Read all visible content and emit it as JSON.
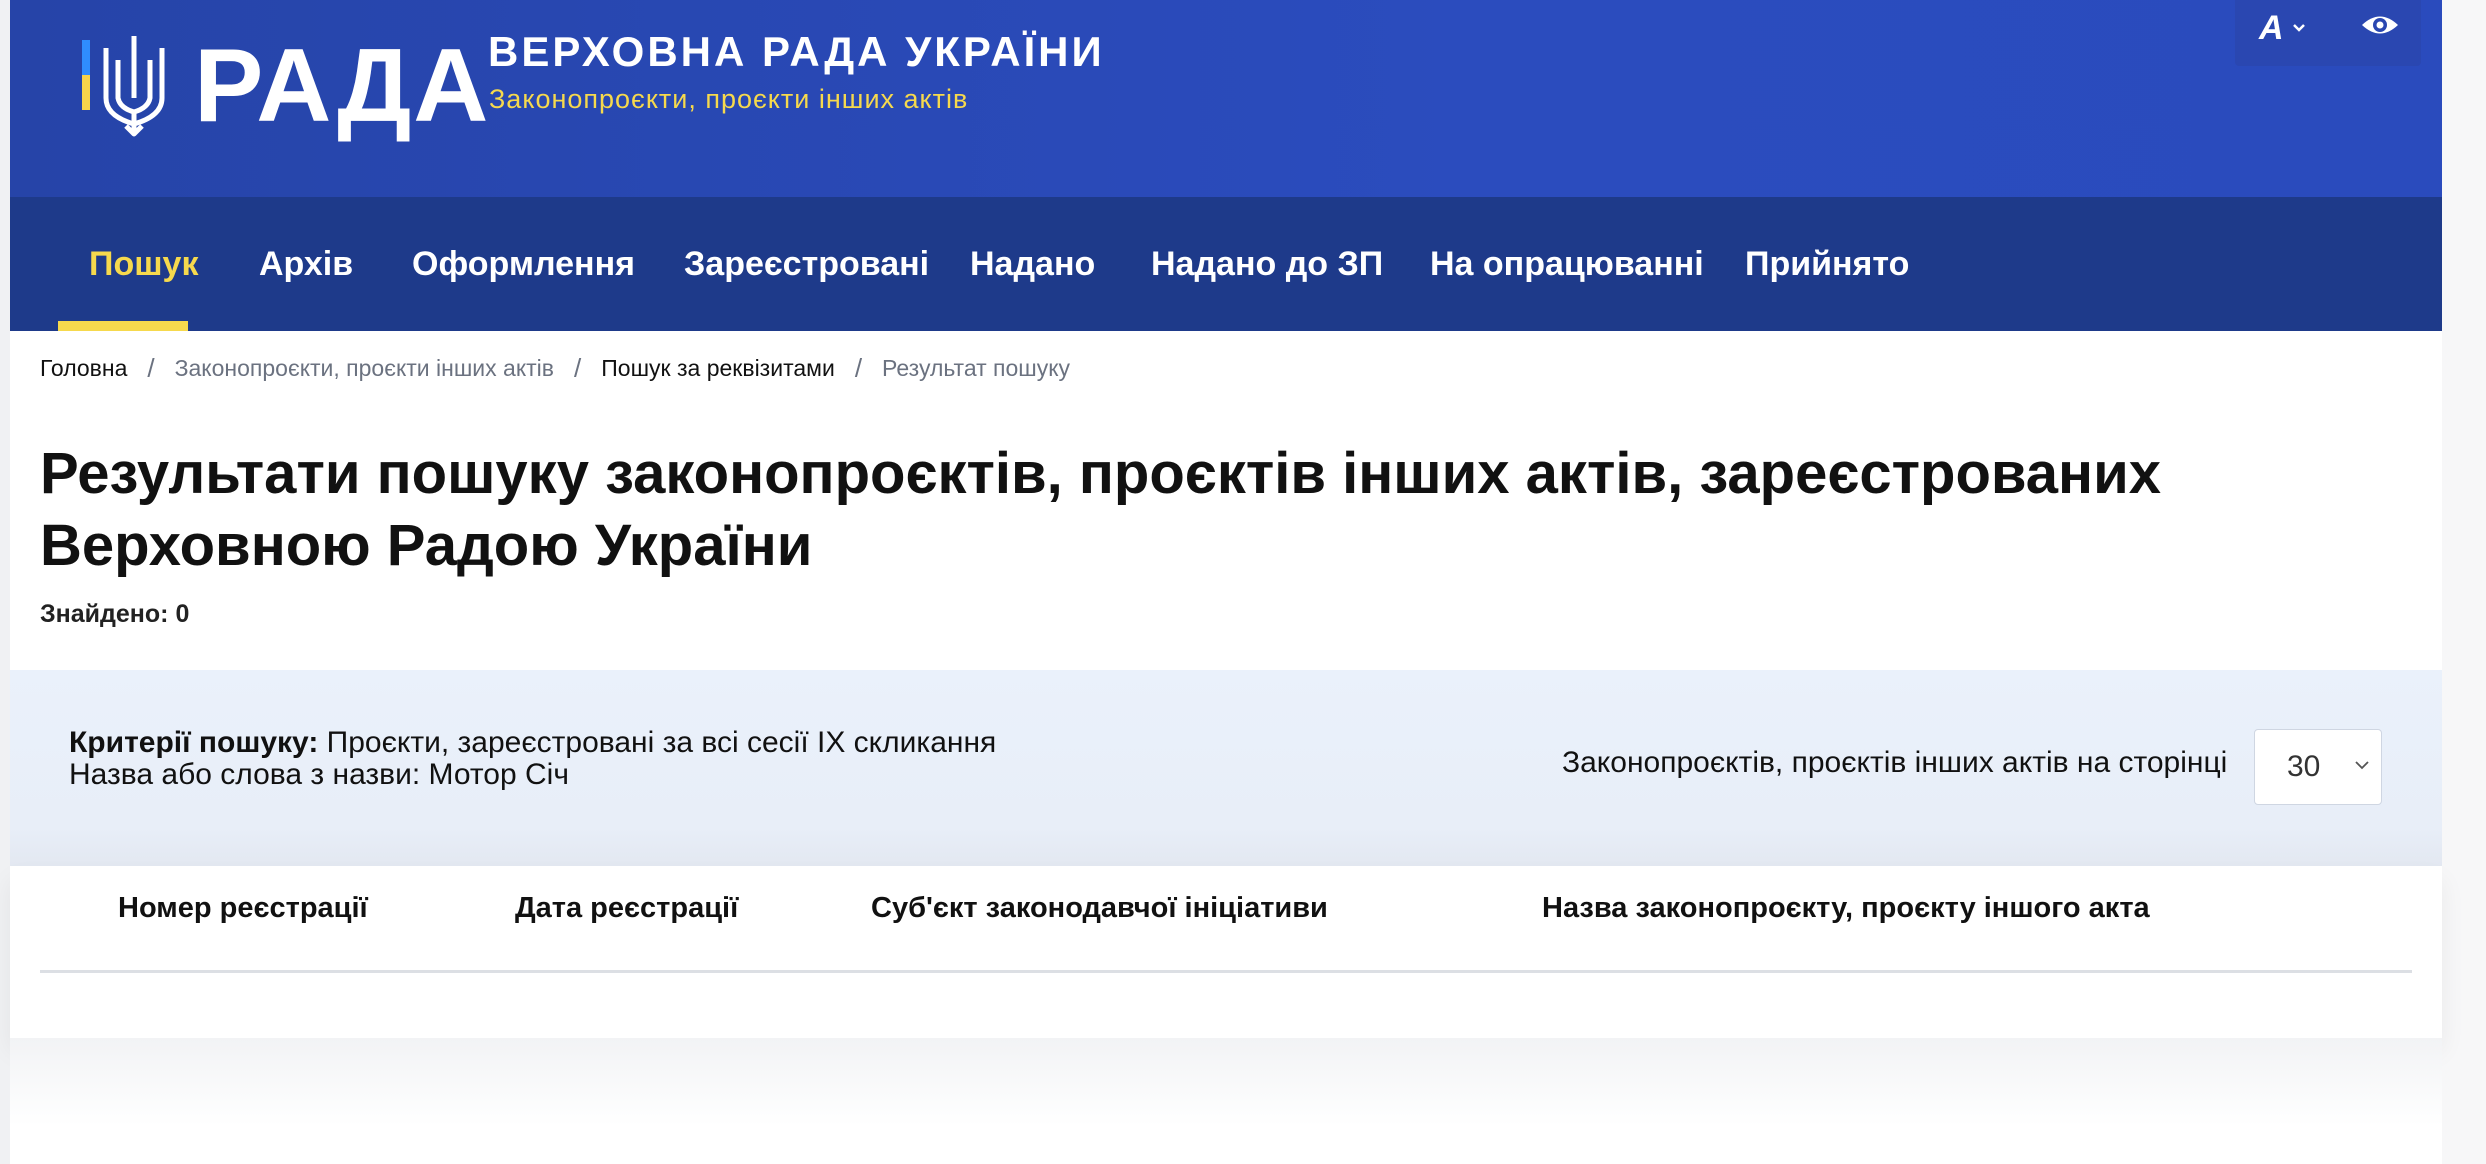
{
  "header": {
    "logo_text": "РАДА",
    "title": "ВЕРХОВНА РАДА УКРАЇНИ",
    "subtitle": "Законопроєкти, проєкти інших актів",
    "font_size_button_label": "A",
    "font_size_button_icon": "chevron-down-icon",
    "accessibility_icon": "eye-icon"
  },
  "nav": {
    "items": [
      {
        "label": "Пошук",
        "active": true
      },
      {
        "label": "Архів",
        "active": false
      },
      {
        "label": "Оформлення",
        "active": false
      },
      {
        "label": "Зареєстровані",
        "active": false
      },
      {
        "label": "Надано",
        "active": false
      },
      {
        "label": "Надано до ЗП",
        "active": false
      },
      {
        "label": "На опрацюванні",
        "active": false
      },
      {
        "label": "Прийнято",
        "active": false
      }
    ]
  },
  "breadcrumb": {
    "items": [
      "Головна",
      "Законопроєкти, проєкти інших актів",
      "Пошук за реквізитами",
      "Результат пошуку"
    ],
    "separator": "/"
  },
  "main": {
    "title": "Результати пошуку законопроєктів, проєктів інших актів, зареєстрованих Верховною Радою України",
    "found": "Знайдено: 0"
  },
  "criteria": {
    "label": "Критерії пошуку:",
    "value": " Проєкти, зареєстровані за всі сесії IX скликання",
    "name_line": "Назва або слова з назви: Мотор Січ",
    "per_page_label": "Законопроєктів, проєктів інших актів на сторінці",
    "per_page_value": "30"
  },
  "table": {
    "columns": [
      "Номер реєстрації",
      "Дата реєстрації",
      "Суб'єкт законодавчої ініціативи",
      "Назва законопроєкту, проєкту іншого акта"
    ],
    "rows": []
  },
  "colors": {
    "header_blue": "#2b4cbe",
    "nav_blue": "#1e3a8a",
    "accent_yellow": "#f6d94d",
    "criteria_bg": "#eaf1fb"
  }
}
